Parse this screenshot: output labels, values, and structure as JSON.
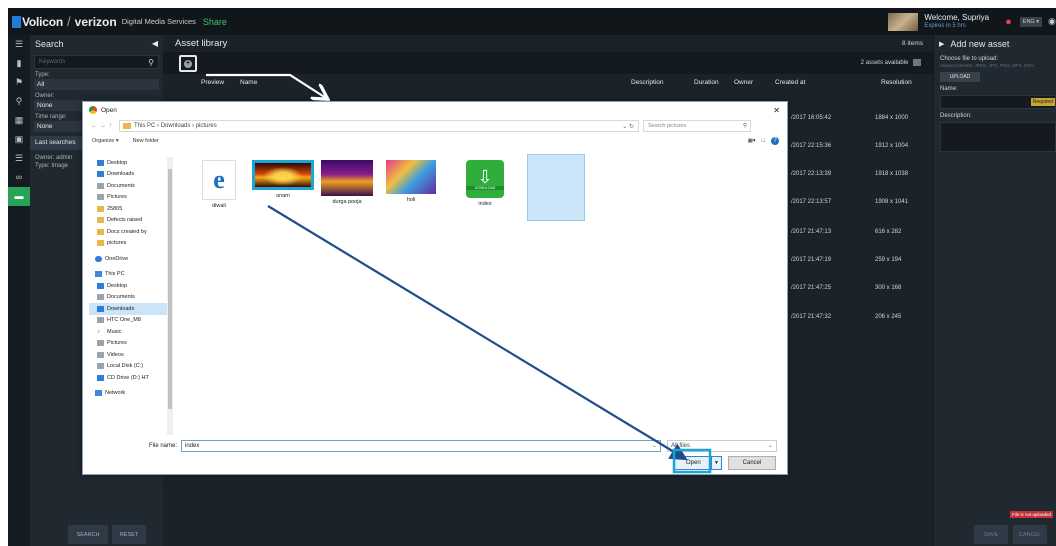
{
  "topbar": {
    "logo_a": "Volicon",
    "logo_sep": "/",
    "logo_b": "verizon",
    "product": "Digital Media Services",
    "share": "Share",
    "welcome": "Welcome, Supriya",
    "expires": "Expires in 5 hrs",
    "lang": "ENG ▾"
  },
  "search_panel": {
    "title": "Search",
    "keywords_placeholder": "Keywords",
    "type_label": "Type:",
    "type_value": "All",
    "owner_label": "Owner:",
    "owner_value": "None",
    "time_label": "Time range:",
    "time_value": "None",
    "last_searches": "Last searches",
    "summary_owner": "Owner: admin",
    "summary_type": "Type: Image",
    "search_button": "SEARCH",
    "reset_button": "RESET"
  },
  "asset_library": {
    "title": "Asset library",
    "items": "8 items",
    "assets_available": "2 assets available",
    "columns": [
      "Preview",
      "Name",
      "Description",
      "Duration",
      "Owner",
      "Created at",
      "Resolution"
    ],
    "rows": [
      {
        "created": "/2017 16:05:42",
        "resolution": "1884 x 1000"
      },
      {
        "created": "/2017 22:15:36",
        "resolution": "1912 x 1004"
      },
      {
        "created": "/2017 22:13:39",
        "resolution": "1918 x 1038"
      },
      {
        "created": "/2017 22:13:57",
        "resolution": "1908 x 1041"
      },
      {
        "created": "/2017 21:47:13",
        "resolution": "616 x 282"
      },
      {
        "created": "/2017 21:47:19",
        "resolution": "259 x 194"
      },
      {
        "created": "/2017 21:47:25",
        "resolution": "300 x 168"
      },
      {
        "created": "/2017 21:47:32",
        "resolution": "206 x 245"
      }
    ]
  },
  "new_asset": {
    "title": "Add new asset",
    "choose_label": "Choose file to upload:",
    "formats": "Allowed formats: JPEG, JPG, PNG, MP4, MOV",
    "upload_button": "UPLOAD",
    "name_label": "Name:",
    "required": "Required",
    "description_label": "Description:",
    "error": "File is not uploaded",
    "save_button": "SAVE",
    "cancel_button": "CANCEL"
  },
  "dialog": {
    "title": "Open",
    "path": [
      "This PC",
      "Downloads",
      "pictures"
    ],
    "search_placeholder": "Search pictures",
    "organize": "Organize ▾",
    "new_folder": "New folder",
    "nav": [
      "Desktop",
      "Downloads",
      "Documents",
      "Pictures",
      "25805",
      "Defects raised",
      "Docs created by",
      "pictures",
      "OneDrive",
      "This PC",
      "Desktop",
      "Documents",
      "Downloads",
      "HTC One_M8",
      "Music",
      "Pictures",
      "Videos",
      "Local Disk (C:)",
      "CD Drive (D:) HT",
      "Network"
    ],
    "files": [
      "diwali",
      "",
      "durga pooja",
      "holi",
      "index"
    ],
    "fire_label": "onam",
    "download_caption": "DOWNLOAD",
    "file_name_label": "File name:",
    "file_name_value": "index",
    "file_type_value": "All files",
    "open_button": "Open",
    "cancel_button": "Cancel"
  },
  "colors": {
    "accent_green": "#27a35a",
    "annotation_blue": "#1e4d8c",
    "highlight_cyan": "#19a6d6"
  }
}
